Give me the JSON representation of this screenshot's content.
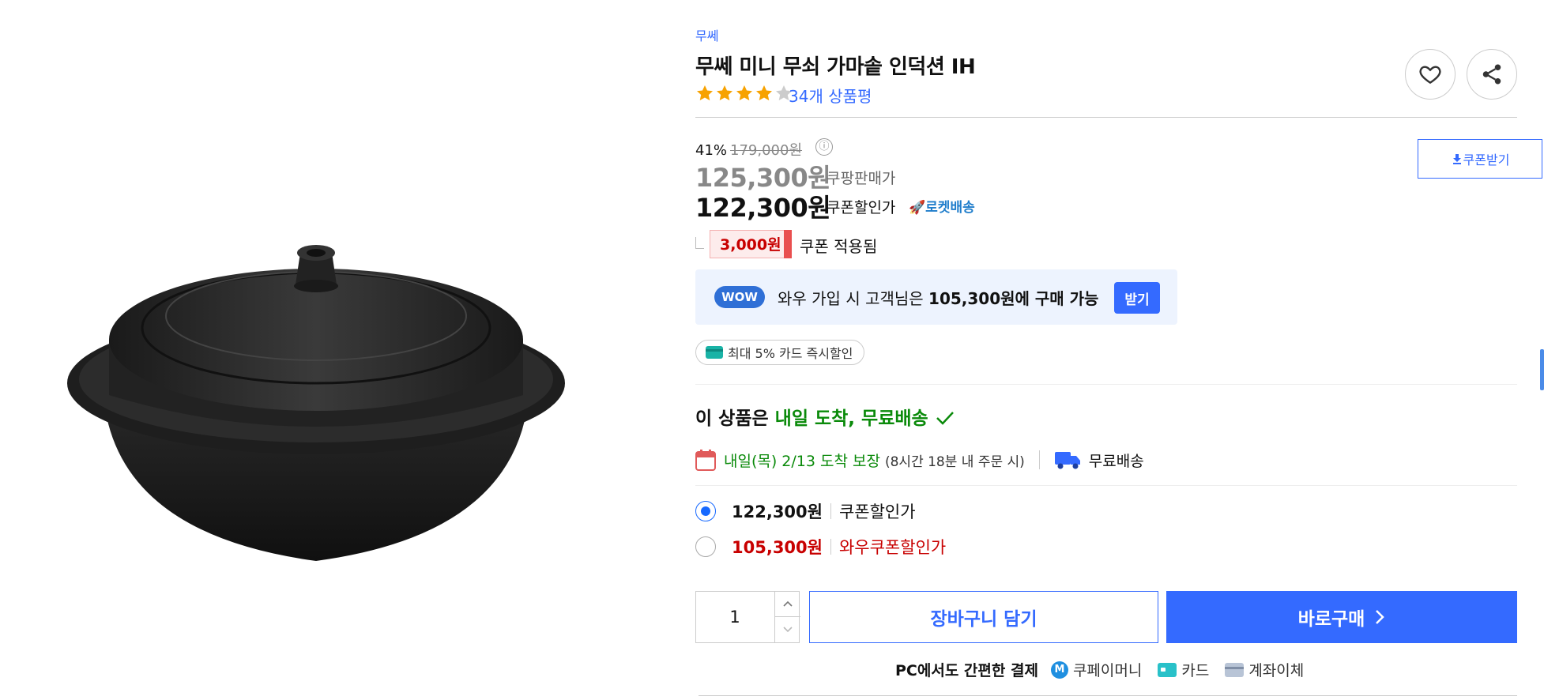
{
  "product": {
    "brand": "무쎄",
    "title": "무쎄 미니 무쇠 가마솥 인덕션 IH",
    "rating": 4,
    "rating_max": 5,
    "review_count": "34개 상품평"
  },
  "price": {
    "discount_rate": "41%",
    "original_price": "179,000원",
    "info_icon": "ⓘ",
    "sale_price": "125,300원",
    "sale_label": "쿠팡판매가",
    "coupon_price": "122,300원",
    "coupon_label": "쿠폰할인가",
    "rocket_label": "로켓배송",
    "coupon_button": "쿠폰받기",
    "coupon_amount": "3,000원",
    "coupon_applied": "쿠폰 적용됨"
  },
  "wow": {
    "badge": "WOW",
    "text_prefix": "와우 가입 시 고객님은 ",
    "text_bold": "105,300원에 구매 가능",
    "button": "받기"
  },
  "card_discount": "최대 5% 카드 즉시할인",
  "delivery": {
    "headline_prefix": "이 상품은 ",
    "headline_green": "내일 도착, 무료배송",
    "arrival_green": "내일(목) 2/13 도착 보장",
    "arrival_note": "(8시간 18분 내 주문 시)",
    "free_shipping": "무료배송"
  },
  "options": [
    {
      "price": "122,300원",
      "label": "쿠폰할인가",
      "selected": true,
      "color": "#111111"
    },
    {
      "price": "105,300원",
      "label": "와우쿠폰할인가",
      "selected": false,
      "color": "#c80000"
    }
  ],
  "purchase": {
    "quantity": "1",
    "cart_button": "장바구니 담기",
    "buy_button": "바로구매"
  },
  "payment": {
    "headline": "PC에서도 간편한 결제",
    "methods": [
      "쿠페이머니",
      "카드",
      "계좌이체"
    ]
  },
  "colors": {
    "accent": "#346aff",
    "green": "#0a8a0a",
    "red": "#c80000"
  }
}
